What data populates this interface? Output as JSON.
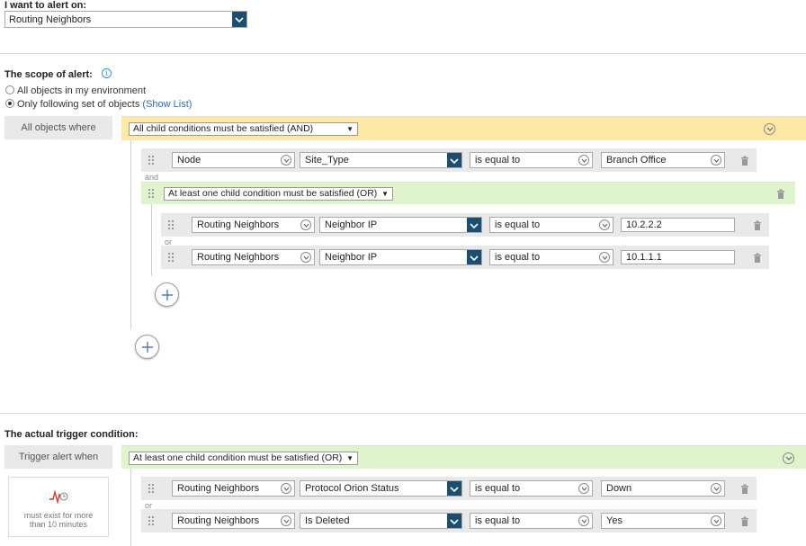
{
  "alert_on": {
    "heading": "I want to alert on:",
    "selected": "Routing Neighbors"
  },
  "scope": {
    "heading": "The scope of alert:",
    "option_all": "All objects in my environment",
    "option_following": "Only following set of objects",
    "show_list_open": "(",
    "show_list": "Show List",
    "show_list_close": ")",
    "side_label": "All objects where",
    "top_group_mode": "All child conditions must be satisfied (AND)",
    "row1": {
      "object": "Node",
      "property": "Site_Type",
      "operator": "is equal to",
      "value": "Branch Office"
    },
    "and_label": "and",
    "subgroup_mode": "At least one child condition must be satisfied (OR)",
    "sub_rows": [
      {
        "object": "Routing Neighbors",
        "property": "Neighbor IP",
        "operator": "is equal to",
        "value": "10.2.2.2"
      },
      {
        "object": "Routing Neighbors",
        "property": "Neighbor IP",
        "operator": "is equal to",
        "value": "10.1.1.1"
      }
    ],
    "or_label": "or"
  },
  "trigger": {
    "heading": "The actual trigger condition:",
    "side_label": "Trigger alert when",
    "group_mode": "At least one child condition must be satisfied (OR)",
    "time_line1": "must exist for more",
    "time_line2": "than 10 minutes",
    "rows": [
      {
        "object": "Routing Neighbors",
        "property": "Protocol Orion Status",
        "operator": "is equal to",
        "value": "Down"
      },
      {
        "object": "Routing Neighbors",
        "property": "Is Deleted",
        "operator": "is equal to",
        "value": "Yes"
      }
    ],
    "or_label": "or"
  },
  "colors": {
    "and_band": "#fde9a5",
    "or_band": "#dff3cc",
    "dropdown_button": "#1b4f72",
    "link": "#2a6ebb"
  },
  "icons": [
    "info-icon",
    "chevron-down-icon",
    "drag-handle-icon",
    "trash-icon",
    "plus-icon",
    "time-icon"
  ]
}
